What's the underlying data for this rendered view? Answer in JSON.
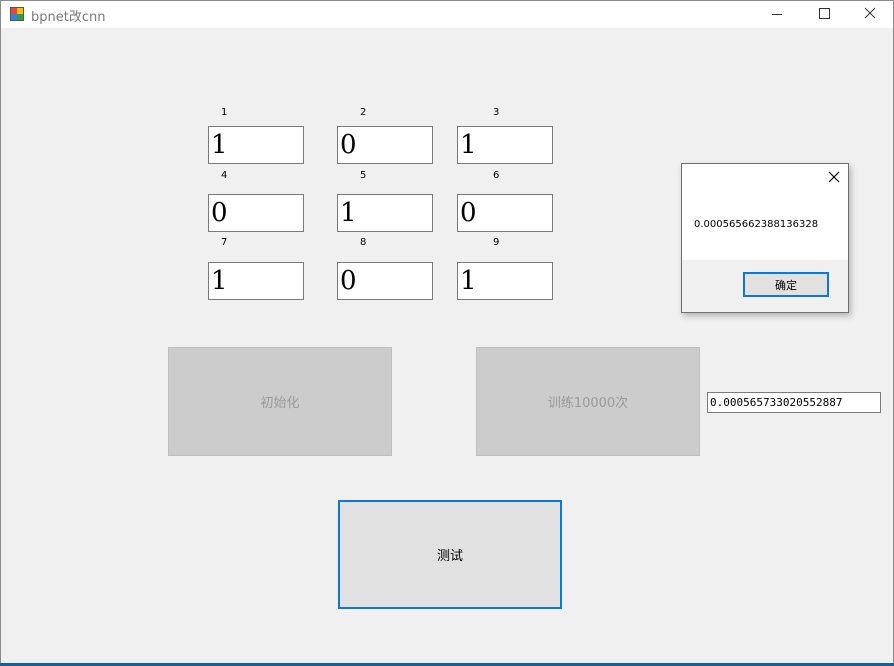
{
  "window": {
    "title": "bpnet改cnn"
  },
  "grid": {
    "cells": [
      {
        "label": "1",
        "value": "1"
      },
      {
        "label": "2",
        "value": "0"
      },
      {
        "label": "3",
        "value": "1"
      },
      {
        "label": "4",
        "value": "0"
      },
      {
        "label": "5",
        "value": "1"
      },
      {
        "label": "6",
        "value": "0"
      },
      {
        "label": "7",
        "value": "1"
      },
      {
        "label": "8",
        "value": "0"
      },
      {
        "label": "9",
        "value": "1"
      }
    ]
  },
  "buttons": {
    "init_label": "初始化",
    "train_label": "训练10000次",
    "test_label": "测试"
  },
  "result": {
    "value": "0.000565733020552887"
  },
  "messagebox": {
    "text": "0.000565662388136328",
    "ok_label": "确定"
  },
  "icons": {
    "app": "app-icon",
    "minimize": "minimize-icon",
    "maximize": "maximize-icon",
    "close": "close-icon"
  },
  "colors": {
    "accent": "#0f78d4",
    "disabled_button": "#cccccc",
    "window_bg": "#f0f0f0"
  }
}
